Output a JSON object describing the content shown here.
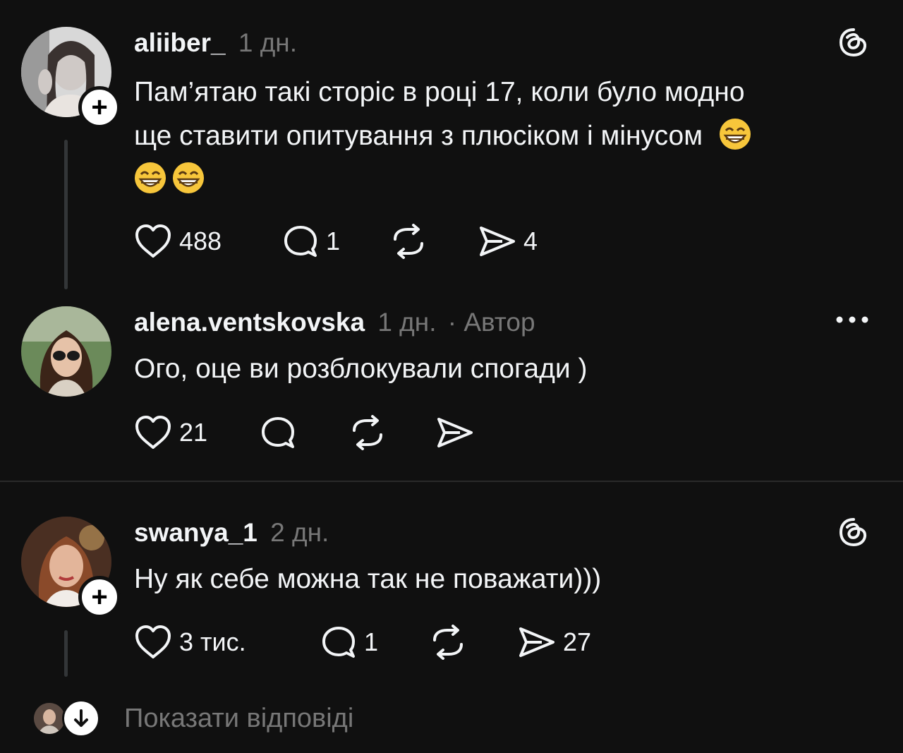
{
  "posts": [
    {
      "username": "aliiber_",
      "time": "1 дн.",
      "text_line1": "Пам’ятаю такі сторіс в році 17, коли було модно",
      "text_line2": "ще ставити опитування з плюсіком і мінусом",
      "likes": "488",
      "replies": "1",
      "shares": "4",
      "corner_icon": "threads-icon"
    },
    {
      "username": "alena.ventskovska",
      "time": "1 дн.",
      "author_badge": "· Автор",
      "text": "Ого, оце ви розблокували спогади )",
      "likes": "21",
      "corner_icon": "more-icon"
    },
    {
      "username": "swanya_1",
      "time": "2 дн.",
      "text": "Ну як себе можна так не поважати)))",
      "likes": "3 тис.",
      "replies": "1",
      "shares": "27",
      "corner_icon": "threads-icon"
    }
  ],
  "show_replies_label": "Показати відповіді",
  "colors": {
    "background": "#101010",
    "text": "#f3f5f7",
    "muted": "#777777"
  }
}
